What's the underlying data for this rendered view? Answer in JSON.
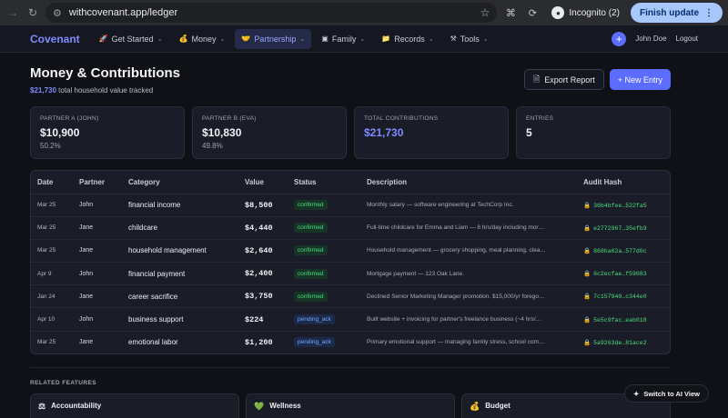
{
  "browser": {
    "url": "withcovenant.app/ledger",
    "incognito_label": "Incognito (2)",
    "finish_update_label": "Finish update"
  },
  "nav": {
    "brand": "Covenant",
    "items": [
      {
        "label": "Get Started",
        "icon": "rocket-icon",
        "glyph": "🚀",
        "active": false
      },
      {
        "label": "Money",
        "icon": "money-bag-icon",
        "glyph": "💰",
        "active": false
      },
      {
        "label": "Partnership",
        "icon": "handshake-icon",
        "glyph": "🤝",
        "active": true
      },
      {
        "label": "Family",
        "icon": "family-icon",
        "glyph": "▣",
        "active": false
      },
      {
        "label": "Records",
        "icon": "folder-icon",
        "glyph": "📁",
        "active": false
      },
      {
        "label": "Tools",
        "icon": "tools-icon",
        "glyph": "⚒",
        "active": false
      }
    ],
    "user_name": "John Doe",
    "logout_label": "Logout"
  },
  "header": {
    "title": "Money & Contributions",
    "total_amount": "$21,730",
    "subtitle_rest": " total household value tracked",
    "export_label": "Export Report",
    "new_entry_label": "+ New Entry"
  },
  "stats": [
    {
      "label": "PARTNER A (JOHN)",
      "value": "$10,900",
      "pct": "50.2%",
      "accent": false
    },
    {
      "label": "PARTNER B (EVA)",
      "value": "$10,830",
      "pct": "49.8%",
      "accent": false
    },
    {
      "label": "TOTAL CONTRIBUTIONS",
      "value": "$21,730",
      "pct": "",
      "accent": true
    },
    {
      "label": "ENTRIES",
      "value": "5",
      "pct": "",
      "accent": false
    }
  ],
  "table": {
    "columns": [
      "Date",
      "Partner",
      "Category",
      "Value",
      "Status",
      "Description",
      "Audit Hash"
    ],
    "rows": [
      {
        "date": "Mar 25",
        "partner": "John",
        "category": "financial income",
        "value": "$8,500",
        "status": "confirmed",
        "description": "Monthly salary — software engineering at TechCorp Inc.",
        "hash": "36b4bfee…522fa5"
      },
      {
        "date": "Mar 25",
        "partner": "Jane",
        "category": "childcare",
        "value": "$4,440",
        "status": "confirmed",
        "description": "Full-time childcare for Emma and Liam — 8 hrs/day including mor…",
        "hash": "e2772967…35efb9"
      },
      {
        "date": "Mar 25",
        "partner": "Jane",
        "category": "household management",
        "value": "$2,640",
        "status": "confirmed",
        "description": "Household management — grocery shopping, meal planning, clea…",
        "hash": "868ba62a…577d0c"
      },
      {
        "date": "Apr 9",
        "partner": "John",
        "category": "financial payment",
        "value": "$2,400",
        "status": "confirmed",
        "description": "Mortgage payment — 123 Oak Lane.",
        "hash": "6c2ecfae…f59083"
      },
      {
        "date": "Jan 24",
        "partner": "Jane",
        "category": "career sacrifice",
        "value": "$3,750",
        "status": "confirmed",
        "description": "Declined Senior Marketing Manager promotion. $15,000/yr forego…",
        "hash": "7c157940…c344e0"
      },
      {
        "date": "Apr 10",
        "partner": "John",
        "category": "business support",
        "value": "$224",
        "status": "pending_ack",
        "description": "Built website + invoicing for partner's freelance business (~4 hrs/…",
        "hash": "5e5c9fac…eab018"
      },
      {
        "date": "Mar 25",
        "partner": "Jane",
        "category": "emotional labor",
        "value": "$1,200",
        "status": "pending_ack",
        "description": "Primary emotional support — managing family stress, school com…",
        "hash": "5a9263de…81ace2"
      }
    ]
  },
  "related": {
    "title": "RELATED FEATURES",
    "features": [
      {
        "label": "Accountability",
        "icon": "scales-icon",
        "glyph": "⚖"
      },
      {
        "label": "Wellness",
        "icon": "green-heart-icon",
        "glyph": "💚"
      },
      {
        "label": "Budget",
        "icon": "money-bag-icon",
        "glyph": "💰"
      }
    ]
  },
  "ai_button_label": "Switch to AI View",
  "colors": {
    "accent": "#5b6cff",
    "confirmed": "#4ade80",
    "pending": "#6fa8ff",
    "background": "#0f1117"
  }
}
